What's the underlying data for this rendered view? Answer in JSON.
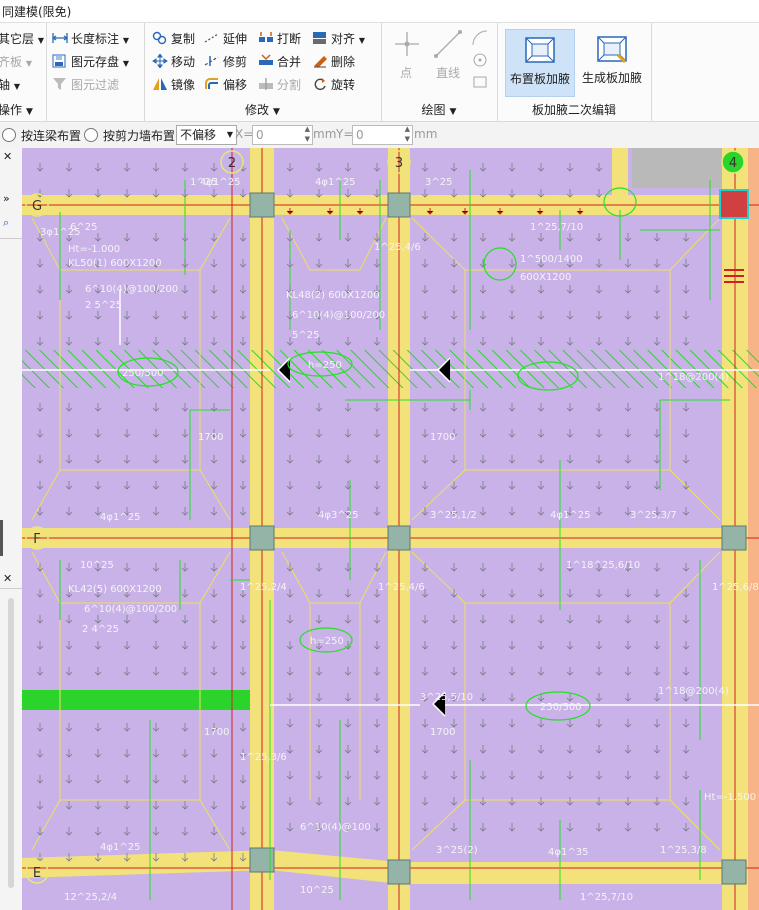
{
  "title": "同建模(限免)",
  "ribbon": {
    "group1": {
      "title": "操作",
      "items": [
        {
          "label": "其它层",
          "disabled": false
        },
        {
          "label": "齐板",
          "disabled": true
        },
        {
          "label": "轴",
          "disabled": false
        }
      ]
    },
    "group2": {
      "items": [
        {
          "label": "长度标注",
          "disabled": false
        },
        {
          "label": "图元存盘",
          "disabled": false
        },
        {
          "label": "图元过滤",
          "disabled": true
        }
      ]
    },
    "modify": {
      "title": "修改",
      "items": [
        {
          "label": "复制",
          "disabled": false
        },
        {
          "label": "延伸",
          "disabled": false
        },
        {
          "label": "打断",
          "disabled": false
        },
        {
          "label": "对齐",
          "disabled": false
        },
        {
          "label": "移动",
          "disabled": false
        },
        {
          "label": "修剪",
          "disabled": false
        },
        {
          "label": "合并",
          "disabled": false
        },
        {
          "label": "删除",
          "disabled": false
        },
        {
          "label": "镜像",
          "disabled": false
        },
        {
          "label": "偏移",
          "disabled": false
        },
        {
          "label": "分割",
          "disabled": true
        },
        {
          "label": "旋转",
          "disabled": false
        }
      ]
    },
    "draw": {
      "title": "绘图",
      "point_label": "点",
      "line_label": "直线"
    },
    "haunch": {
      "title": "板加腋二次编辑",
      "place_label": "布置板加腋",
      "generate_label": "生成板加腋"
    }
  },
  "options": {
    "beam_label": "按连梁布置",
    "wall_label": "按剪力墙布置",
    "offset_value": "不偏移",
    "x_label": "X=",
    "x_value": "0",
    "x_unit": "mm",
    "y_label": "Y=",
    "y_value": "0",
    "y_unit": "mm"
  },
  "grid": {
    "axis_labels": [
      "2",
      "3",
      "4",
      "G",
      "F",
      "E"
    ]
  },
  "annotations": [
    "1^25",
    "4φ1^25",
    "3^25",
    "1^25,7/10",
    "6^25",
    "4φ1^25",
    "3φ1^25",
    "Ht=-1.000",
    "KL50(1) 600X1200",
    "6^10(4)@100/200",
    "2 5^25",
    "1^25,4/6",
    "1^500/1400",
    "600X1200",
    "KL48(2) 600X1200",
    "6^10(4)@100/200",
    "5^25",
    "250/500",
    "h=250",
    "1^18@200(4)",
    "1700",
    "1700",
    "4φ1^25",
    "4φ3^25",
    "3^25,1/2",
    "4φ1^25",
    "3^25,3/7",
    "10^25",
    "1^18^25,6/10",
    "KL42(5) 600X1200",
    "6^10(4)@100/200",
    "2 4^25",
    "1^25,2/4",
    "h=250",
    "1^25,6/8",
    "250/500",
    "1^18@200(4)",
    "1700",
    "1700",
    "1^25,4/6",
    "3^25,5/10",
    "1^25,3/6",
    "6^10(4)@100",
    "4φ1^25",
    "3^25(2)",
    "4φ1^35",
    "1^25,3/8",
    "10^25",
    "1^25,7/10",
    "12^25,2/4",
    "Ht=-1.500"
  ]
}
